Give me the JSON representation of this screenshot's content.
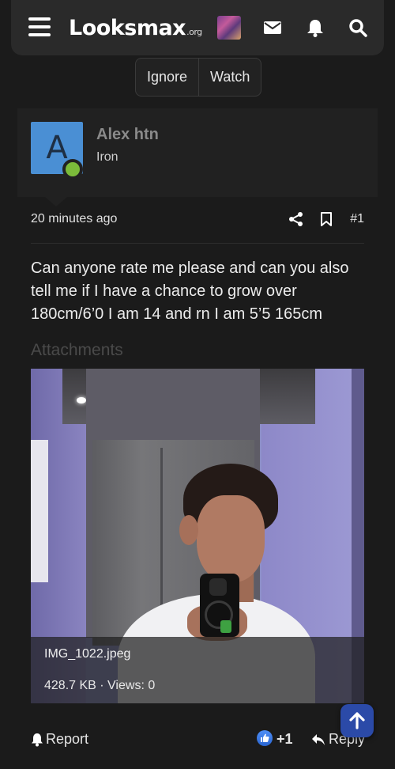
{
  "header": {
    "logo_text": "Looksmax",
    "logo_suffix": ".org",
    "icons": [
      "menu-icon",
      "user-avatar",
      "mail-icon",
      "bell-icon",
      "search-icon"
    ]
  },
  "thread_actions": {
    "ignore_label": "Ignore",
    "watch_label": "Watch"
  },
  "post": {
    "author": {
      "name": "Alex htn",
      "title": "Iron",
      "avatar_letter": "A",
      "avatar_color": "#4a8fd4",
      "online": true
    },
    "timestamp": "20 minutes ago",
    "post_number": "#1",
    "message": "Can anyone rate me please and can you also tell me if I have a chance to grow over 180cm/6’0 I am 14 and rn I am 5’5 165cm",
    "attachments_heading": "Attachments",
    "attachment": {
      "filename": "IMG_1022.jpeg",
      "meta": "428.7 KB · Views: 0"
    },
    "footer": {
      "report_label": "Report",
      "like_count": "+1",
      "reply_label": "Reply"
    }
  },
  "colors": {
    "background": "#1b1b1b",
    "panel": "#2a2a2a",
    "accent_blue": "#2b4aa8",
    "online_green": "#7bbb3a"
  }
}
